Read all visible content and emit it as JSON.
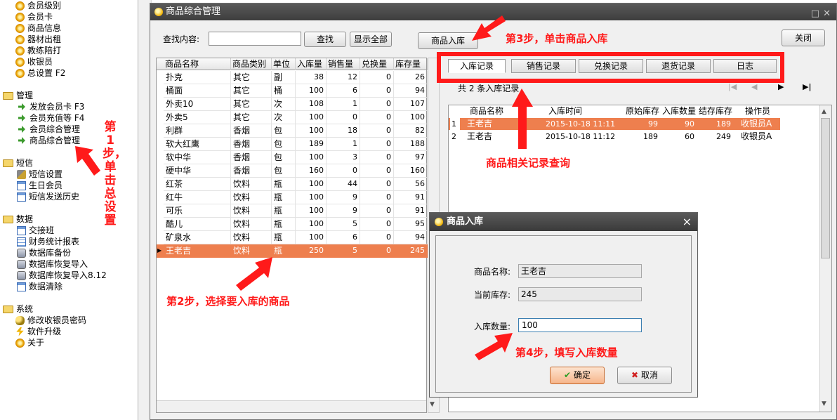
{
  "tree": {
    "items_top": [
      "会员级别",
      "会员卡",
      "商品信息",
      "器材出租",
      "教练陪打",
      "收银员",
      "总设置 F2"
    ],
    "group_manage": "管理",
    "items_manage": [
      "发放会员卡 F3",
      "会员充值等 F4",
      "会员综合管理",
      "商品综合管理"
    ],
    "group_sms": "短信",
    "items_sms": [
      "短信设置",
      "生日会员",
      "短信发送历史"
    ],
    "group_data": "数据",
    "items_data": [
      "交接班",
      "财务统计报表",
      "数据库备份",
      "数据库恢复导入",
      "数据库恢复导入8.12",
      "数据清除"
    ],
    "group_system": "系统",
    "items_system": [
      "修改收银员密码",
      "软件升级",
      "关于"
    ]
  },
  "window": {
    "title": "商品综合管理",
    "search_label": "查找内容:",
    "search_value": "",
    "find_btn": "查找",
    "show_all_btn": "显示全部",
    "stock_in_btn": "商品入库",
    "close_btn": "关闭"
  },
  "product_grid": {
    "headers": [
      "商品名称",
      "商品类别",
      "单位",
      "入库量",
      "销售量",
      "兑换量",
      "库存量"
    ],
    "rows": [
      [
        "扑克",
        "其它",
        "副",
        "38",
        "12",
        "0",
        "26"
      ],
      [
        "桶面",
        "其它",
        "桶",
        "100",
        "6",
        "0",
        "94"
      ],
      [
        "外卖10",
        "其它",
        "次",
        "108",
        "1",
        "0",
        "107"
      ],
      [
        "外卖5",
        "其它",
        "次",
        "100",
        "0",
        "0",
        "100"
      ],
      [
        "利群",
        "香烟",
        "包",
        "100",
        "18",
        "0",
        "82"
      ],
      [
        "软大红鹰",
        "香烟",
        "包",
        "189",
        "1",
        "0",
        "188"
      ],
      [
        "软中华",
        "香烟",
        "包",
        "100",
        "3",
        "0",
        "97"
      ],
      [
        "硬中华",
        "香烟",
        "包",
        "160",
        "0",
        "0",
        "160"
      ],
      [
        "红茶",
        "饮料",
        "瓶",
        "100",
        "44",
        "0",
        "56"
      ],
      [
        "红牛",
        "饮料",
        "瓶",
        "100",
        "9",
        "0",
        "91"
      ],
      [
        "可乐",
        "饮料",
        "瓶",
        "100",
        "9",
        "0",
        "91"
      ],
      [
        "酷儿",
        "饮料",
        "瓶",
        "100",
        "5",
        "0",
        "95"
      ],
      [
        "矿泉水",
        "饮料",
        "瓶",
        "100",
        "6",
        "0",
        "94"
      ],
      [
        "王老吉",
        "饮料",
        "瓶",
        "250",
        "5",
        "0",
        "245"
      ]
    ],
    "selected_row": 13
  },
  "tabs": [
    "入库记录",
    "销售记录",
    "兑换记录",
    "退货记录",
    "日志"
  ],
  "record_count": "共 2 条入库记录",
  "nav_last": "▶|",
  "record_grid": {
    "headers": [
      "商品名称",
      "入库时间",
      "原始库存",
      "入库数量",
      "结存库存",
      "操作员"
    ],
    "rows": [
      [
        "1",
        "王老吉",
        "2015-10-18 11:11",
        "99",
        "90",
        "189",
        "收银员A"
      ],
      [
        "2",
        "王老吉",
        "2015-10-18 11:12",
        "189",
        "60",
        "249",
        "收银员A"
      ]
    ]
  },
  "dialog": {
    "title": "商品入库",
    "name_label": "商品名称:",
    "name_value": "王老吉",
    "stock_label": "当前库存:",
    "stock_value": "245",
    "qty_label": "入库数量:",
    "qty_value": "100",
    "ok_btn": "确定",
    "cancel_btn": "取消",
    "close_x": "×"
  },
  "annotations": {
    "step1": "第1步，单击总设置",
    "step2": "第2步，选择要入库的商品",
    "step3": "第3步，单击商品入库",
    "step4": "第4步，填写入库数量",
    "query": "商品相关记录查询"
  },
  "colors": {
    "accent_selected": "#ee7f4e",
    "annotation_red": "#ff1a1a"
  }
}
